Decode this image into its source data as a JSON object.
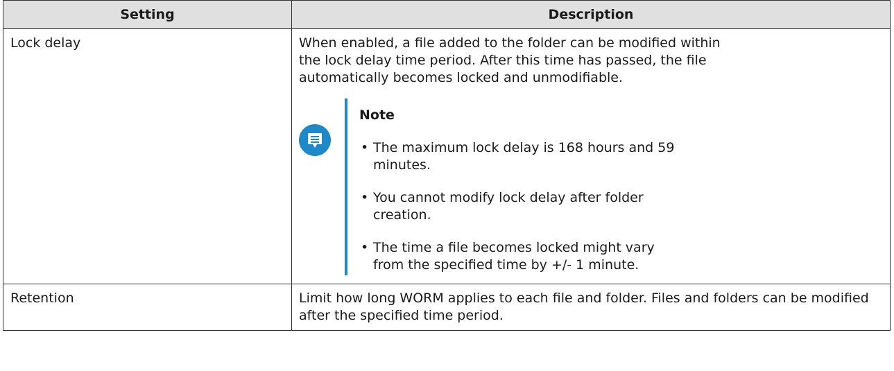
{
  "table": {
    "headers": {
      "setting": "Setting",
      "description": "Description"
    },
    "rows": [
      {
        "setting": "Lock delay",
        "description": "When enabled, a file added to the folder can be modified within the lock delay time period. After this time has passed, the file automatically becomes locked and unmodifiable.",
        "note": {
          "title": "Note",
          "icon": "note-icon",
          "items": [
            "The maximum lock delay is 168 hours and 59 minutes.",
            "You cannot modify lock delay after folder creation.",
            "The time a file becomes locked might vary from the specified time by +/- 1 minute."
          ]
        }
      },
      {
        "setting": "Retention",
        "description": "Limit how long WORM applies to each file and folder. Files and folders can be modified after the specified time period."
      }
    ]
  },
  "colors": {
    "accent": "#1f88c9",
    "header_bg": "#e0e0e0",
    "border": "#333333"
  },
  "bullet": "•"
}
